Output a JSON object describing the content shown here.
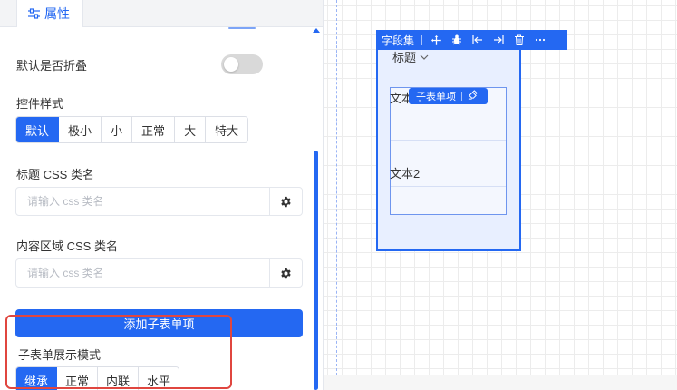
{
  "panel": {
    "tab_label": "属性",
    "collapse_default_label": "默认是否折叠",
    "control_style_label": "控件样式",
    "control_style_options": [
      "默认",
      "极小",
      "小",
      "正常",
      "大",
      "特大"
    ],
    "title_css_label": "标题 CSS 类名",
    "title_css_placeholder": "请输入 css 类名",
    "content_css_label": "内容区域 CSS 类名",
    "content_css_placeholder": "请输入 css 类名",
    "add_subform_button": "添加子表单项",
    "subform_mode_label": "子表单展示模式",
    "subform_mode_options": [
      "继承",
      "正常",
      "内联",
      "水平"
    ]
  },
  "canvas": {
    "fieldset_toolbar_label": "字段集",
    "fieldset_title": "标题",
    "subform_toolbar_label": "子表单项",
    "text_1": "文本",
    "text_2": "文本2"
  },
  "colors": {
    "accent": "#2468f2",
    "highlight": "#e0463f"
  },
  "icons": [
    "sliders-icon",
    "move-icon",
    "bug-icon",
    "arrow-left-bar-icon",
    "arrow-right-bar-icon",
    "trash-icon",
    "more-icon",
    "gear-icon",
    "chevron-down-icon",
    "paint-icon"
  ]
}
